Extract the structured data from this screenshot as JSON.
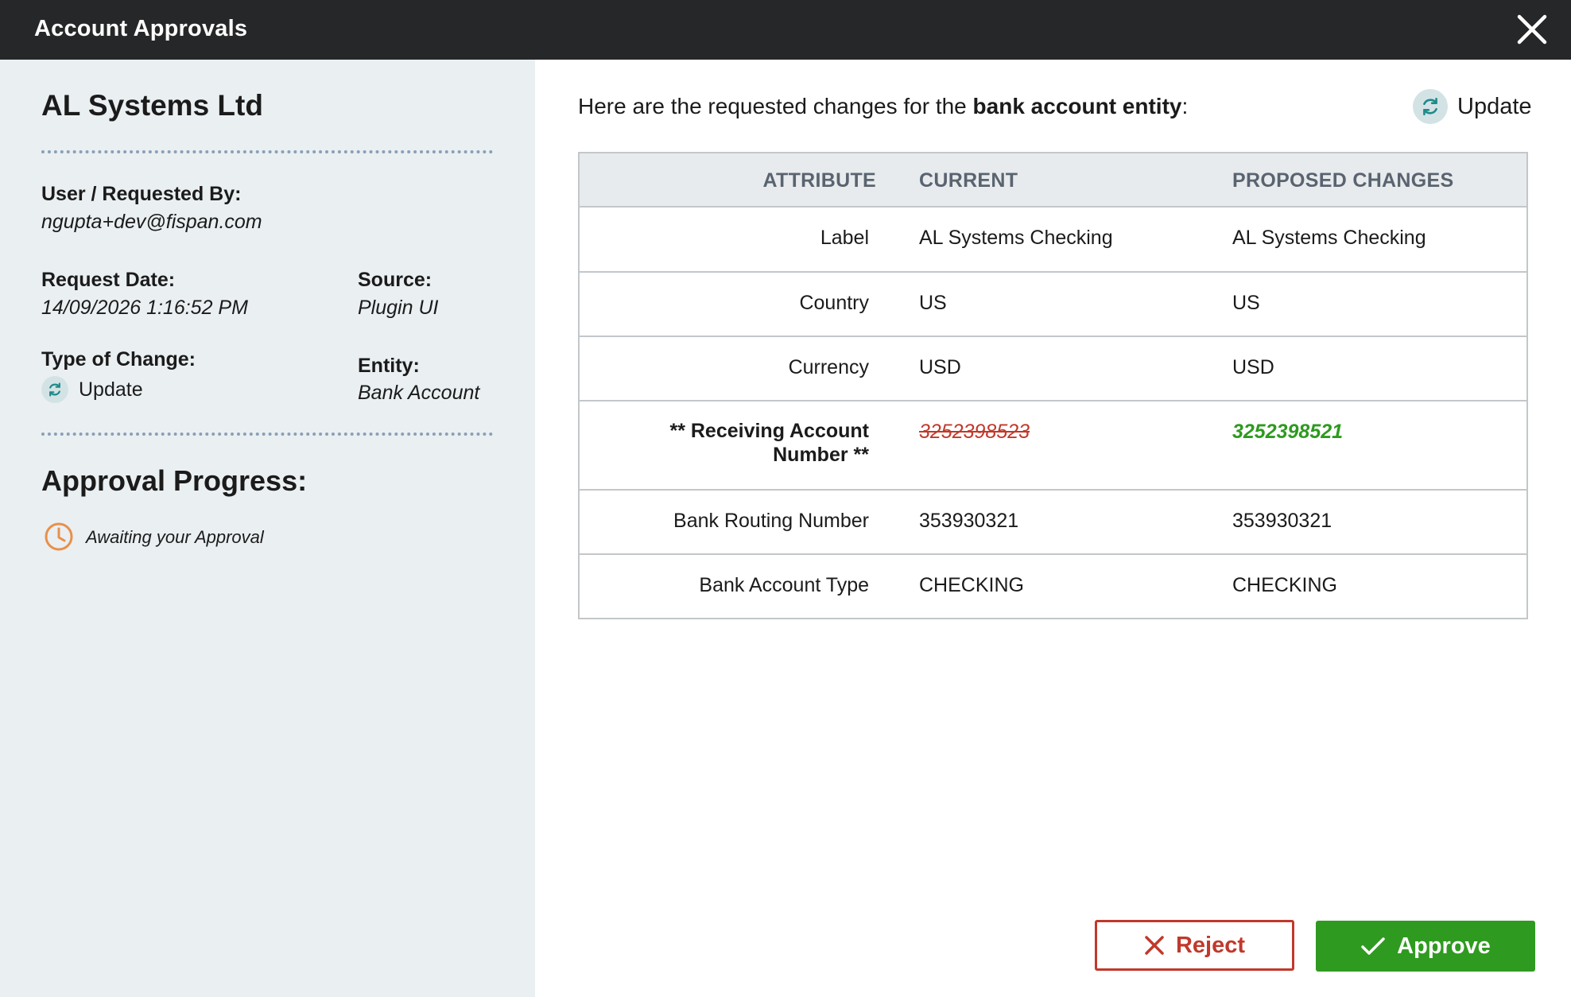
{
  "window": {
    "title": "Account Approvals"
  },
  "sidebar": {
    "company": "AL Systems Ltd",
    "requested_by_label": "User / Requested By:",
    "requested_by_value": "ngupta+dev@fispan.com",
    "request_date_label": "Request Date:",
    "request_date_value": "14/09/2026 1:16:52 PM",
    "source_label": "Source:",
    "source_value": "Plugin UI",
    "type_label": "Type of Change:",
    "type_value": "Update",
    "entity_label": "Entity:",
    "entity_value": "Bank Account",
    "progress_title": "Approval Progress:",
    "progress_status": "Awaiting your Approval"
  },
  "main": {
    "intro_prefix": "Here are the requested changes for the ",
    "intro_bold": "bank account entity",
    "intro_suffix": ":",
    "update_label": "Update",
    "table": {
      "headers": [
        "ATTRIBUTE",
        "CURRENT",
        "PROPOSED CHANGES"
      ],
      "rows": [
        {
          "attribute": "Label",
          "current": "AL Systems Checking",
          "proposed": "AL Systems Checking"
        },
        {
          "attribute": "Country",
          "current": "US",
          "proposed": "US"
        },
        {
          "attribute": "Currency",
          "current": "USD",
          "proposed": "USD"
        },
        {
          "attribute_line1": "** Receiving Account",
          "attribute_line2": "Number **",
          "current": "3252398523",
          "proposed": "3252398521",
          "changed": true
        },
        {
          "attribute": "Bank Routing Number",
          "current": "353930321",
          "proposed": "353930321"
        },
        {
          "attribute": "Bank Account Type",
          "current": "CHECKING",
          "proposed": "CHECKING"
        }
      ]
    }
  },
  "actions": {
    "reject_label": "Reject",
    "approve_label": "Approve"
  },
  "colors": {
    "titlebar": "#262728",
    "sidebar_bg": "#eaeff2",
    "reject": "#c0392b",
    "approve": "#2f9a20",
    "update_icon": "#1f8a8a",
    "clock_icon": "#e8904a"
  },
  "icons": {
    "close": "close-icon",
    "update": "refresh-icon",
    "progress": "clock-icon",
    "reject": "x-icon",
    "approve": "check-icon"
  }
}
